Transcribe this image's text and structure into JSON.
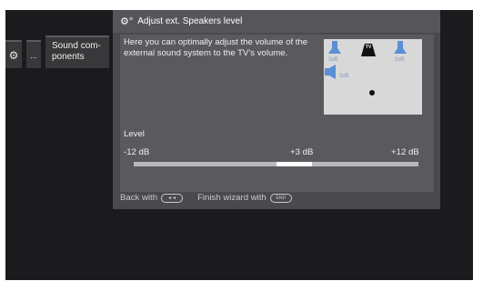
{
  "menu": {
    "gear_icon": "gear-icon",
    "dots_label": "...",
    "sound_components_label": "Sound com-\nponents"
  },
  "wizard": {
    "title_icon": "gears-icon",
    "title": "Adjust ext. Speakers level",
    "description": "Here you can optimally adjust the volume of the external sound system to the TV's volume.",
    "diagram": {
      "tv_label": "TV",
      "front_left_db": "3dB",
      "front_right_db": "3dB",
      "side_left_db": "3dB",
      "speaker_color": "#5b8fd6"
    },
    "level": {
      "label": "Level",
      "min_label": "-12 dB",
      "current_label": "+3 dB",
      "max_label": "+12 dB",
      "min_value": -12,
      "max_value": 12,
      "highlight_from": 0,
      "highlight_to": 3
    },
    "footer": {
      "back_label": "Back with",
      "back_key": "◄◄",
      "finish_label": "Finish wizard with",
      "finish_key": "END"
    }
  }
}
